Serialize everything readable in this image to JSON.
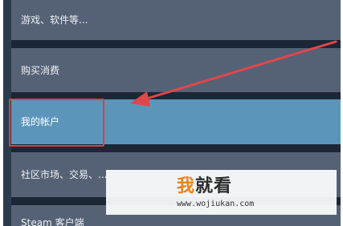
{
  "menu": {
    "items": [
      {
        "label": "游戏、软件等..."
      },
      {
        "label": "购买消费"
      },
      {
        "label": "我的帐户"
      },
      {
        "label": "社区市场、交易、..."
      },
      {
        "label": "Steam 客户端"
      }
    ],
    "active_index": 2
  },
  "annotation": {
    "color": "#e0464a",
    "icon": "arrow-icon"
  },
  "watermark": {
    "brand_first": "我",
    "brand_rest": "就看",
    "url": "www.wojiukan.com"
  },
  "colors": {
    "menu_bg": "#556275",
    "active_bg": "#5b96ba",
    "panel_bg": "#1c2735"
  }
}
